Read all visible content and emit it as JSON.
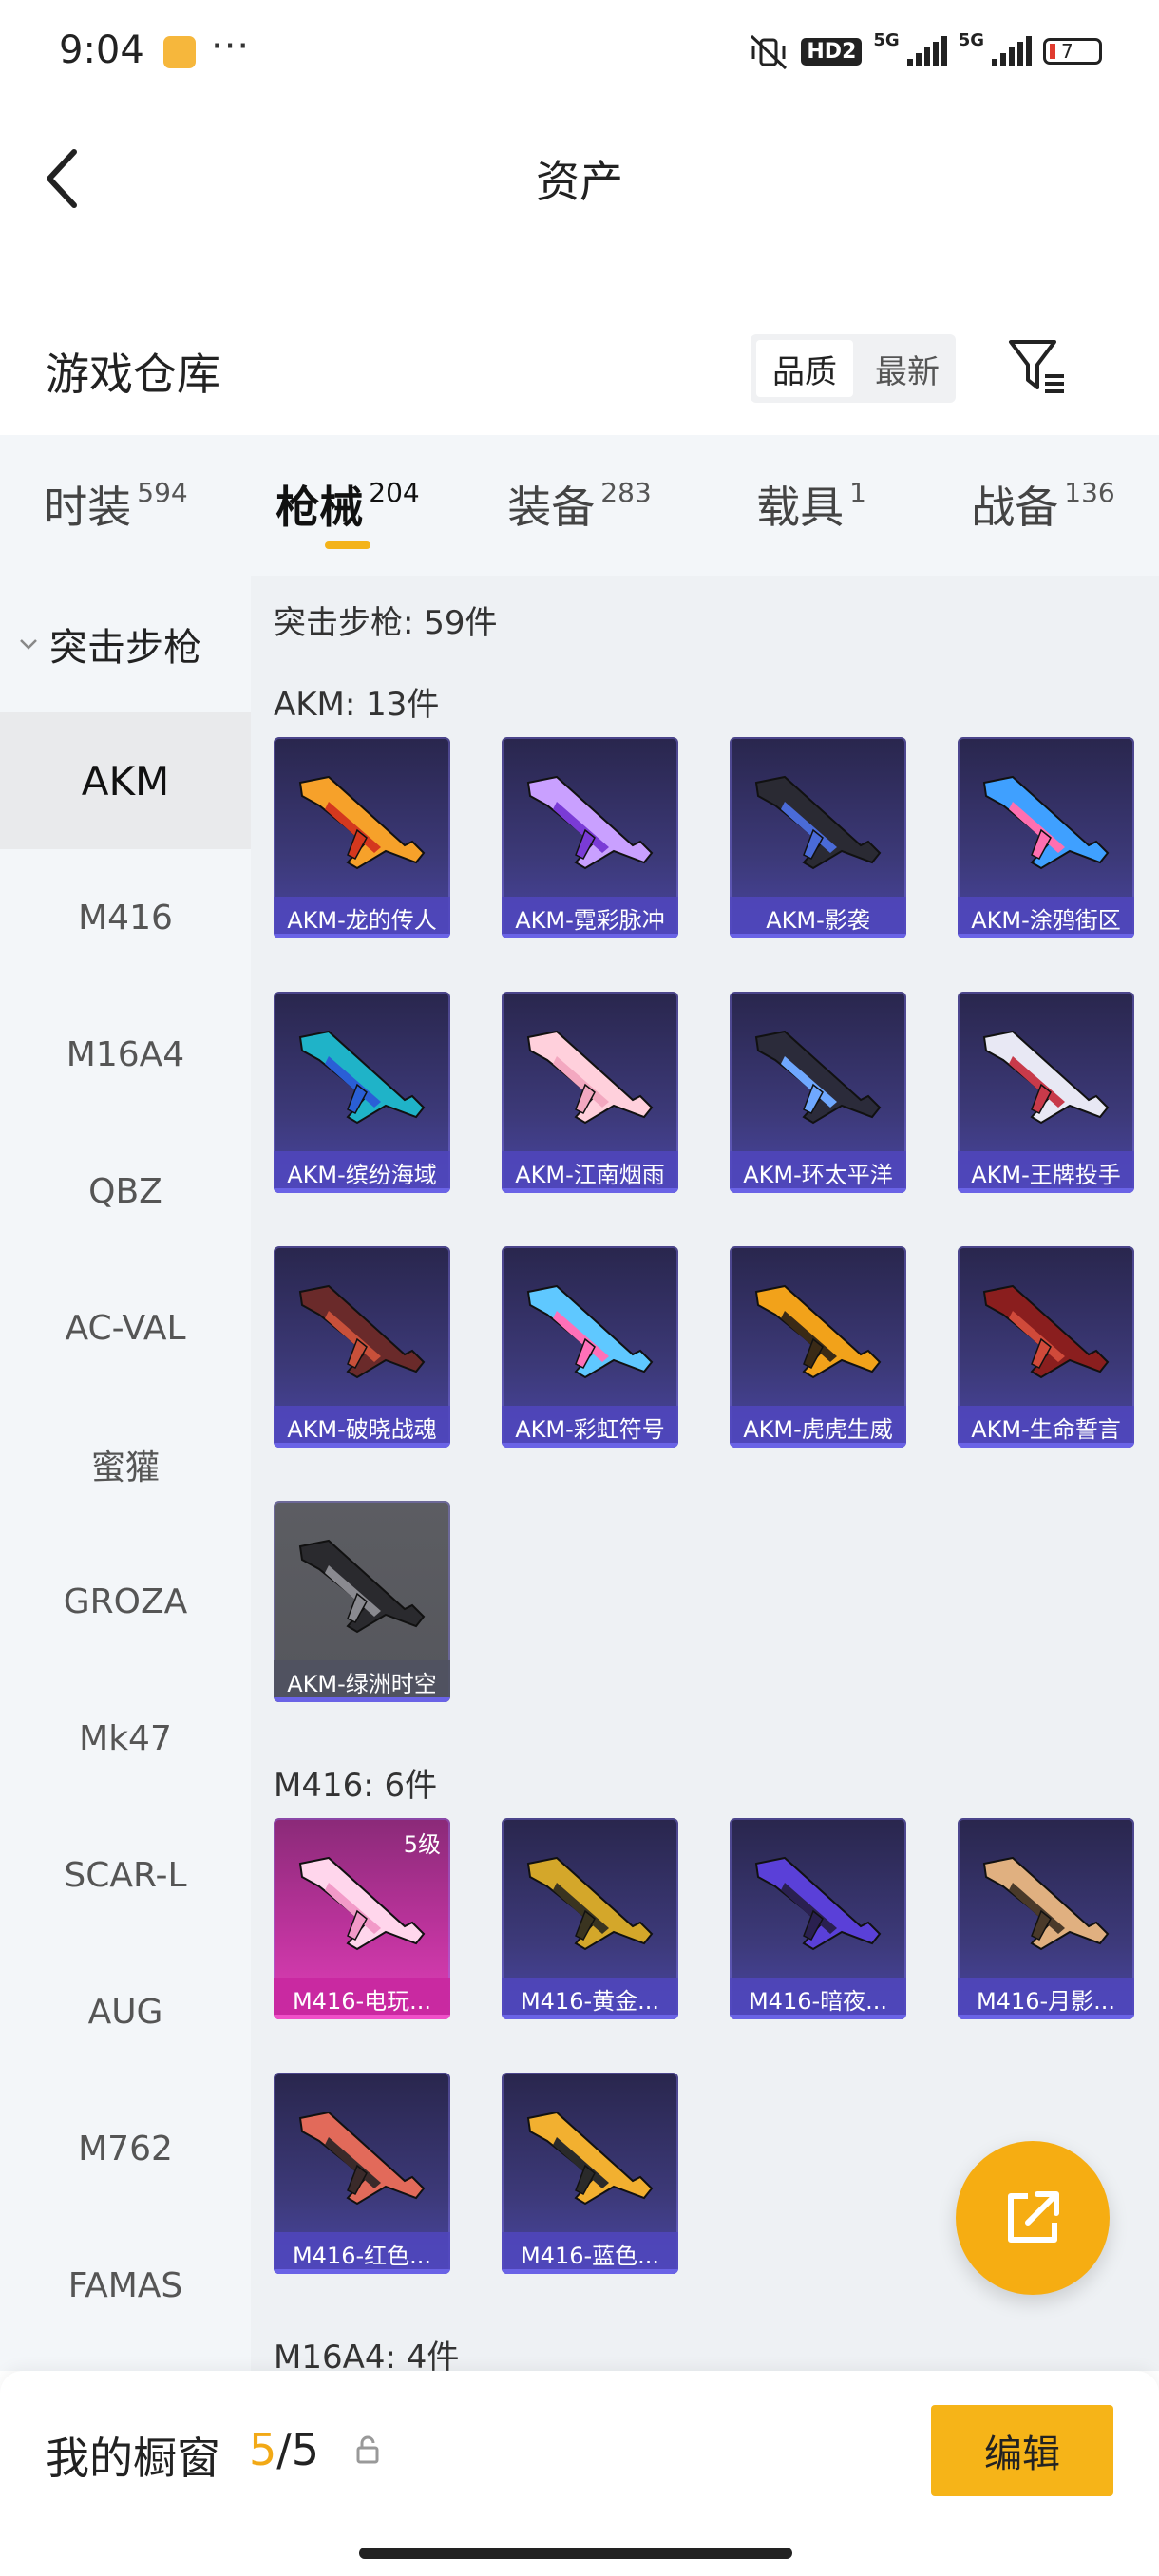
{
  "status": {
    "time": "9:04",
    "battery": "7",
    "net1": "5G",
    "net2": "5G",
    "hd": "HD2"
  },
  "nav": {
    "title": "资产"
  },
  "section": {
    "title": "游戏仓库",
    "sort": [
      "品质",
      "最新"
    ]
  },
  "tabs": [
    {
      "name": "时装",
      "count": "594"
    },
    {
      "name": "枪械",
      "count": "204"
    },
    {
      "name": "装备",
      "count": "283"
    },
    {
      "name": "载具",
      "count": "1"
    },
    {
      "name": "战备",
      "count": "136"
    }
  ],
  "sidebar": {
    "header": "突击步枪",
    "items": [
      "AKM",
      "M416",
      "M16A4",
      "QBZ",
      "AC-VAL",
      "蜜獾",
      "GROZA",
      "Mk47",
      "SCAR-L",
      "AUG",
      "M762",
      "FAMAS"
    ]
  },
  "content": {
    "summary": "突击步枪: 59件",
    "groups": [
      {
        "label": "AKM: 13件",
        "items": [
          {
            "name": "AKM-龙的传人",
            "colors": [
              "#f6a12a",
              "#d4381e"
            ]
          },
          {
            "name": "AKM-霓彩脉冲",
            "colors": [
              "#c9a0ff",
              "#7a3bd6"
            ]
          },
          {
            "name": "AKM-影袭",
            "colors": [
              "#2a2a33",
              "#4a6bd8"
            ]
          },
          {
            "name": "AKM-涂鸦街区",
            "colors": [
              "#3fa0ff",
              "#ff6fb0"
            ]
          },
          {
            "name": "AKM-缤纷海域",
            "colors": [
              "#1fb3c8",
              "#2a5fd6"
            ]
          },
          {
            "name": "AKM-江南烟雨",
            "colors": [
              "#ffd0dc",
              "#f3a8c0"
            ]
          },
          {
            "name": "AKM-环太平洋",
            "colors": [
              "#2b2b3a",
              "#6fa8ff"
            ]
          },
          {
            "name": "AKM-王牌投手",
            "colors": [
              "#e8e8f4",
              "#c83a4a"
            ]
          },
          {
            "name": "AKM-破晓战魂",
            "colors": [
              "#6a2a2a",
              "#c8503a"
            ]
          },
          {
            "name": "AKM-彩虹符号",
            "colors": [
              "#5fc8ff",
              "#ff70b8"
            ]
          },
          {
            "name": "AKM-虎虎生威",
            "colors": [
              "#f2a21a",
              "#3a2a16"
            ]
          },
          {
            "name": "AKM-生命誓言",
            "colors": [
              "#8a1e1e",
              "#d04a3a"
            ]
          },
          {
            "name": "AKM-绿洲时空",
            "colors": [
              "#2a2a2e",
              "#8a8a90"
            ],
            "style": "grey"
          }
        ]
      },
      {
        "label": "M416: 6件",
        "items": [
          {
            "name": "M416-电玩...",
            "colors": [
              "#ffd6ec",
              "#f29ac8"
            ],
            "style": "pink",
            "level": "5级"
          },
          {
            "name": "M416-黄金...",
            "colors": [
              "#d4a72a",
              "#3a3420"
            ]
          },
          {
            "name": "M416-暗夜...",
            "colors": [
              "#5a40d8",
              "#2a2050"
            ]
          },
          {
            "name": "M416-月影...",
            "colors": [
              "#e0b080",
              "#4a3a2a"
            ]
          },
          {
            "name": "M416-红色...",
            "colors": [
              "#e26a5a",
              "#3a2a2a"
            ]
          },
          {
            "name": "M416-蓝色...",
            "colors": [
              "#f2b030",
              "#2a2a2a"
            ]
          }
        ]
      },
      {
        "label": "M16A4: 4件",
        "items": []
      }
    ]
  },
  "bottom": {
    "label": "我的橱窗",
    "current": "5",
    "total": "/5",
    "edit": "编辑"
  }
}
